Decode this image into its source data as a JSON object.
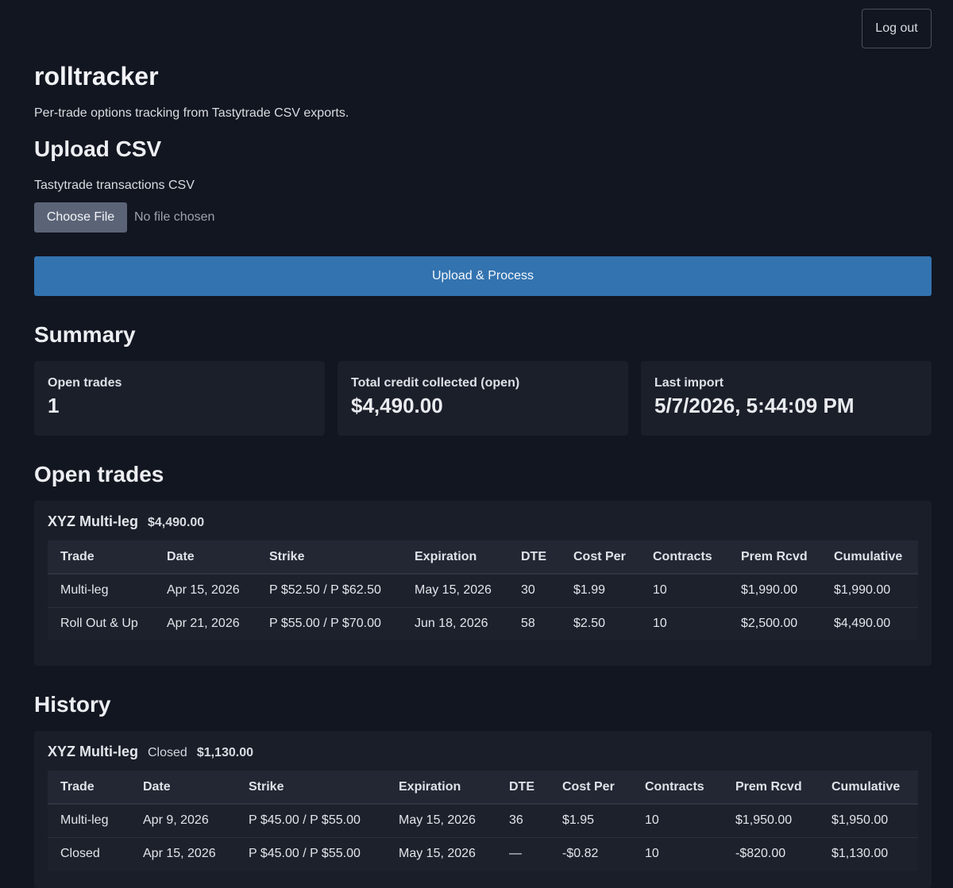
{
  "header": {
    "logout_label": "Log out",
    "title": "rolltracker",
    "subtitle": "Per-trade options tracking from Tastytrade CSV exports."
  },
  "upload": {
    "heading": "Upload CSV",
    "file_label": "Tastytrade transactions CSV",
    "choose_label": "Choose File",
    "file_status": "No file chosen",
    "submit_label": "Upload & Process"
  },
  "summary": {
    "heading": "Summary",
    "cards": [
      {
        "label": "Open trades",
        "value": "1"
      },
      {
        "label": "Total credit collected (open)",
        "value": "$4,490.00"
      },
      {
        "label": "Last import",
        "value": "5/7/2026, 5:44:09 PM"
      }
    ]
  },
  "open_trades": {
    "heading": "Open trades",
    "symbol": "XYZ Multi-leg",
    "total": "$4,490.00",
    "columns": [
      "Trade",
      "Date",
      "Strike",
      "Expiration",
      "DTE",
      "Cost Per",
      "Contracts",
      "Prem Rcvd",
      "Cumulative"
    ],
    "rows": [
      [
        "Multi-leg",
        "Apr 15, 2026",
        "P $52.50 / P $62.50",
        "May 15, 2026",
        "30",
        "$1.99",
        "10",
        "$1,990.00",
        "$1,990.00"
      ],
      [
        "Roll Out & Up",
        "Apr 21, 2026",
        "P $55.00 / P $70.00",
        "Jun 18, 2026",
        "58",
        "$2.50",
        "10",
        "$2,500.00",
        "$4,490.00"
      ]
    ]
  },
  "history": {
    "heading": "History",
    "symbol": "XYZ Multi-leg",
    "status": "Closed",
    "total": "$1,130.00",
    "columns": [
      "Trade",
      "Date",
      "Strike",
      "Expiration",
      "DTE",
      "Cost Per",
      "Contracts",
      "Prem Rcvd",
      "Cumulative"
    ],
    "rows": [
      [
        "Multi-leg",
        "Apr 9, 2026",
        "P $45.00 / P $55.00",
        "May 15, 2026",
        "36",
        "$1.95",
        "10",
        "$1,950.00",
        "$1,950.00"
      ],
      [
        "Closed",
        "Apr 15, 2026",
        "P $45.00 / P $55.00",
        "May 15, 2026",
        "—",
        "-$0.82",
        "10",
        "-$820.00",
        "$1,130.00"
      ]
    ]
  }
}
